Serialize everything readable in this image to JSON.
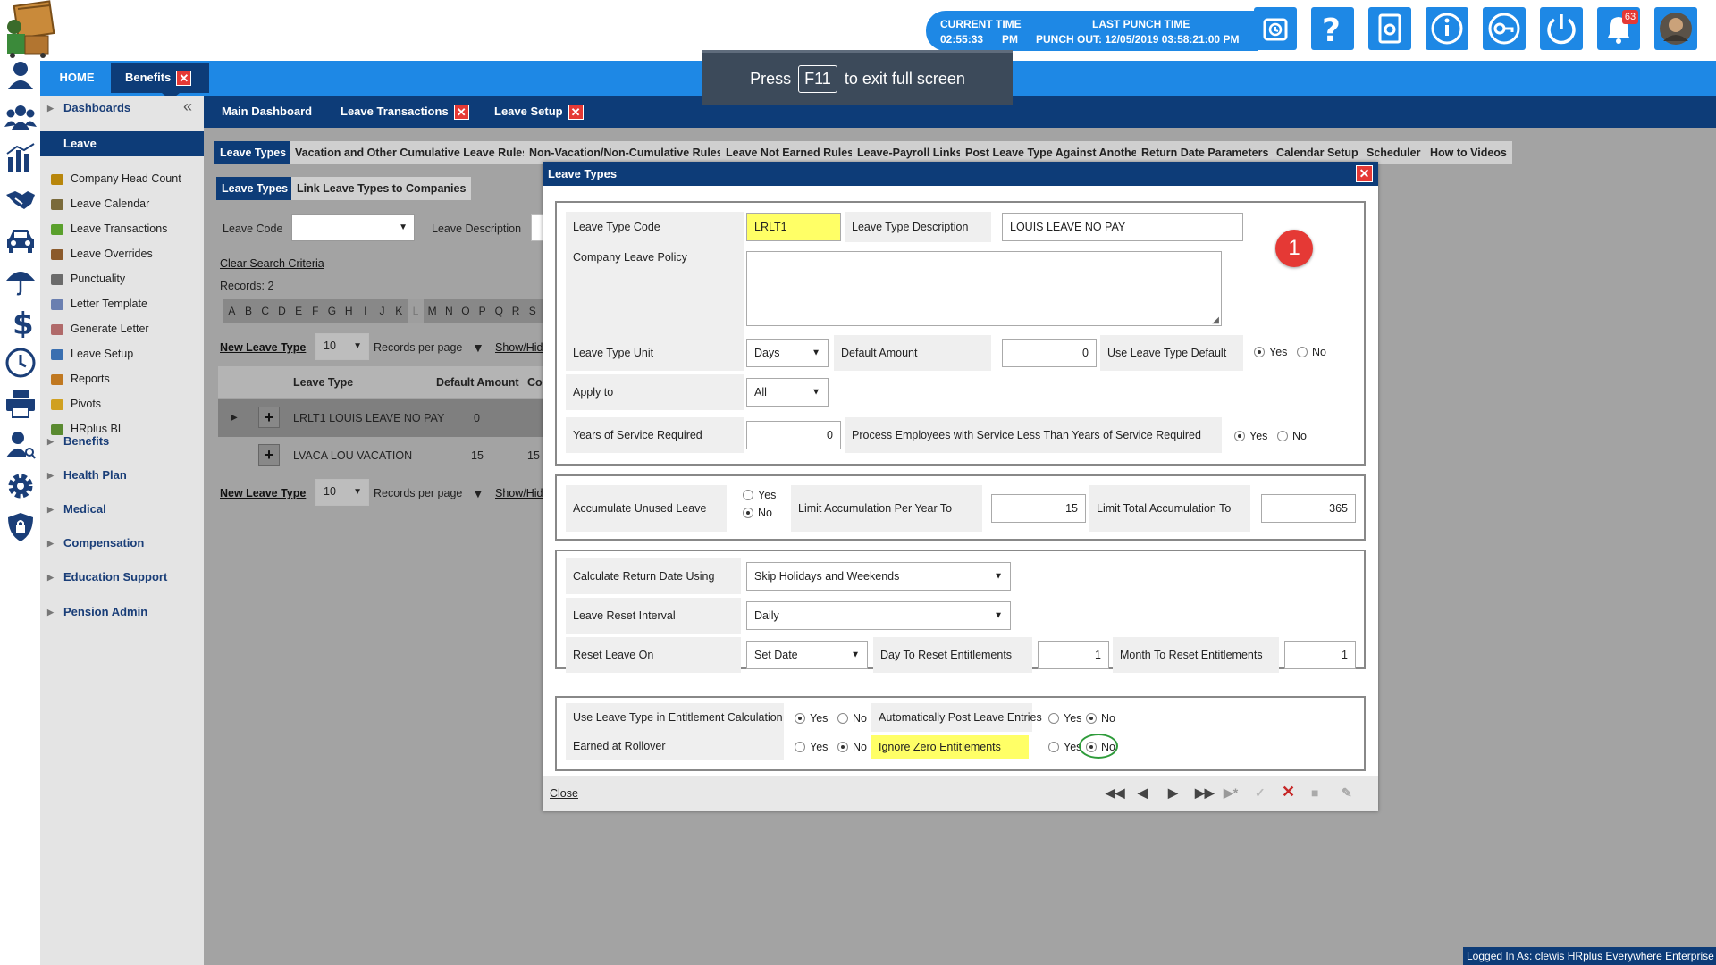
{
  "header": {
    "current_time_label": "CURRENT TIME",
    "current_time_value": "02:55:33",
    "current_time_ampm": "PM",
    "last_punch_label": "LAST PUNCH TIME",
    "last_punch_value": "PUNCH OUT: 12/05/2019 03:58:21:00 PM",
    "notification_count": "63"
  },
  "tabs": {
    "home": "HOME",
    "benefits": "Benefits",
    "close_glyph": "✕"
  },
  "fullscreen_notice": {
    "press": "Press",
    "key": "F11",
    "rest": "to exit full screen"
  },
  "subnav": {
    "main_dashboard": "Main Dashboard",
    "leave_transactions": "Leave Transactions",
    "leave_setup": "Leave Setup"
  },
  "sidebar": {
    "dashboards": "Dashboards",
    "leave": "Leave",
    "leave_items": [
      "Company Head Count",
      "Leave Calendar",
      "Leave Transactions",
      "Leave Overrides",
      "Punctuality",
      "Letter Template",
      "Generate Letter",
      "Leave Setup",
      "Reports",
      "Pivots",
      "HRplus BI"
    ],
    "groups": [
      "Benefits",
      "Health Plan",
      "Medical",
      "Compensation",
      "Education Support",
      "Pension Admin"
    ]
  },
  "setup_tabs": [
    "Leave Types",
    "Vacation and Other Cumulative Leave Rules",
    "Non-Vacation/Non-Cumulative Rules",
    "Leave Not Earned Rules",
    "Leave-Payroll Links",
    "Post Leave Type Against Another",
    "Return Date Parameters",
    "Calendar Setup",
    "Scheduler",
    "How to Videos"
  ],
  "sub_tabs": [
    "Leave Types",
    "Link Leave Types to Companies"
  ],
  "search": {
    "leave_code_label": "Leave Code",
    "leave_description_label": "Leave Description",
    "clear_search": "Clear Search Criteria",
    "records": "Records: 2",
    "alphabet": [
      "A",
      "B",
      "C",
      "D",
      "E",
      "F",
      "G",
      "H",
      "I",
      "J",
      "K",
      "L",
      "M",
      "N",
      "O",
      "P",
      "Q",
      "R",
      "S"
    ],
    "new_leave_type": "New Leave Type",
    "per_page_value": "10",
    "records_per_page": "Records per page",
    "show_hide": "Show/Hid"
  },
  "grid": {
    "headers": [
      "Leave Type",
      "Default Amount",
      "Co"
    ],
    "rows": [
      {
        "type": "LRLT1  LOUIS LEAVE NO PAY",
        "amount": "0",
        "extra": ""
      },
      {
        "type": "LVACA  LOU VACATION",
        "amount": "15",
        "extra": "15"
      }
    ]
  },
  "dialog": {
    "title": "Leave Types",
    "close_glyph": "✕",
    "step_badge": "1",
    "yes": "Yes",
    "no": "No",
    "s1": {
      "leave_type_code_label": "Leave Type Code",
      "leave_type_code": "LRLT1",
      "leave_type_desc_label": "Leave Type Description",
      "leave_type_desc": "LOUIS LEAVE NO PAY",
      "company_policy_label": "Company Leave Policy",
      "unit_label": "Leave Type Unit",
      "unit_value": "Days",
      "default_amount_label": "Default Amount",
      "default_amount": "0",
      "use_default_label": "Use Leave Type Default",
      "apply_to_label": "Apply to",
      "apply_to_value": "All",
      "years_service_label": "Years of Service Required",
      "years_service": "0",
      "process_label": "Process Employees with Service Less Than Years of Service Required"
    },
    "s2": {
      "accumulate_label": "Accumulate Unused Leave",
      "limit_year_label": "Limit Accumulation Per Year To",
      "limit_year": "15",
      "limit_total_label": "Limit Total Accumulation To",
      "limit_total": "365"
    },
    "s3": {
      "calc_label": "Calculate Return Date Using",
      "calc_value": "Skip Holidays and Weekends",
      "reset_interval_label": "Leave Reset Interval",
      "reset_interval": "Daily",
      "reset_on_label": "Reset Leave On",
      "reset_on": "Set Date",
      "day_label": "Day To Reset Entitlements",
      "day": "1",
      "month_label": "Month To Reset Entitlements",
      "month": "1"
    },
    "s4": {
      "use_in_calc_label": "Use Leave Type in Entitlement Calculation",
      "auto_post_label": "Automatically Post Leave Entries",
      "earned_rollover_label": "Earned at Rollover",
      "ignore_zero_label": "Ignore Zero Entitlements"
    },
    "footer": {
      "close": "Close"
    }
  },
  "status": "Logged In As: clewis HRplus Everywhere Enterprise",
  "colors": {
    "primary_blue": "#1e88e5",
    "dark_navy": "#0d3c78",
    "close_red": "#e53935",
    "highlight_yellow": "#ffff66",
    "focus_green": "#2e9b3a"
  }
}
